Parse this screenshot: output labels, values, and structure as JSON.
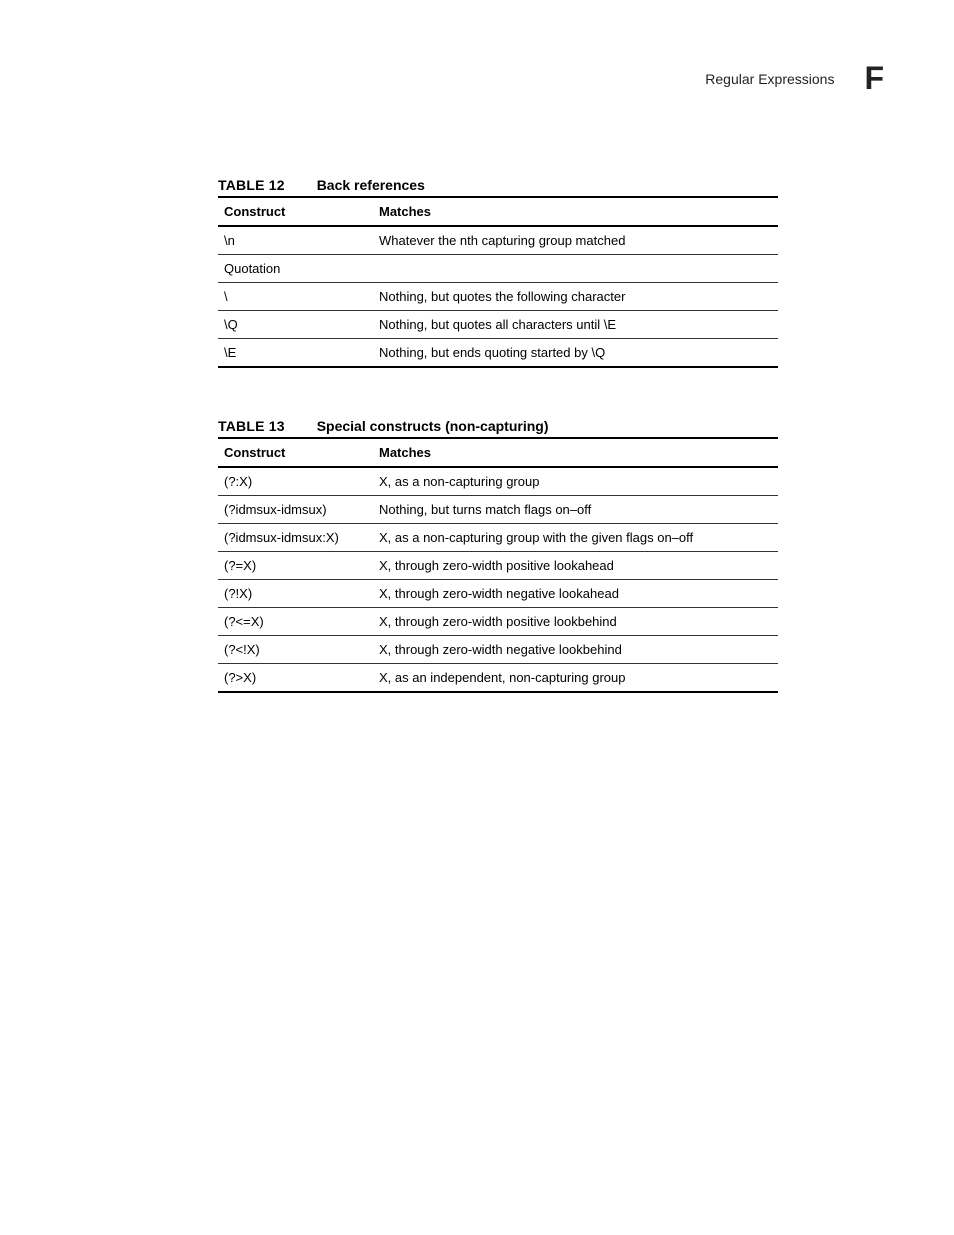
{
  "header": {
    "title": "Regular Expressions",
    "letter": "F"
  },
  "table12": {
    "label": "TABLE 12",
    "title": "Back references",
    "col_construct": "Construct",
    "col_matches": "Matches",
    "rows": [
      {
        "construct": "\\n",
        "matches": "Whatever the nth capturing group matched"
      },
      {
        "construct": "Quotation",
        "matches": ""
      },
      {
        "construct": "\\",
        "matches": "Nothing, but quotes the following character"
      },
      {
        "construct": "\\Q",
        "matches": "Nothing, but quotes all characters until \\E"
      },
      {
        "construct": "\\E",
        "matches": "Nothing, but ends quoting started by \\Q"
      }
    ]
  },
  "table13": {
    "label": "TABLE 13",
    "title": "Special constructs (non-capturing)",
    "col_construct": "Construct",
    "col_matches": "Matches",
    "rows": [
      {
        "construct": "(?:X)",
        "matches": "X, as a non-capturing group"
      },
      {
        "construct": "(?idmsux-idmsux)",
        "matches": "Nothing, but turns match flags on–off"
      },
      {
        "construct": "(?idmsux-idmsux:X)",
        "matches": "X, as a non-capturing group with the given flags on–off"
      },
      {
        "construct": "(?=X)",
        "matches": "X, through zero-width positive lookahead"
      },
      {
        "construct": "(?!X)",
        "matches": "X, through zero-width negative lookahead"
      },
      {
        "construct": "(?<=X)",
        "matches": "X, through zero-width positive lookbehind"
      },
      {
        "construct": "(?<!X)",
        "matches": "X, through zero-width negative lookbehind"
      },
      {
        "construct": "(?>X)",
        "matches": "X, as an independent, non-capturing group"
      }
    ]
  }
}
